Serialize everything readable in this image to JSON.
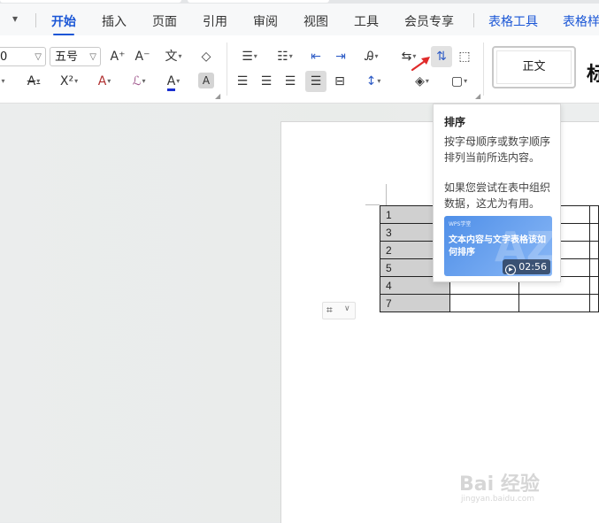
{
  "ribbon_tabs": {
    "items": [
      {
        "label": "开始",
        "active": true
      },
      {
        "label": "插入"
      },
      {
        "label": "页面"
      },
      {
        "label": "引用"
      },
      {
        "label": "审阅"
      },
      {
        "label": "视图"
      },
      {
        "label": "工具"
      },
      {
        "label": "会员专享"
      }
    ],
    "contextual": [
      {
        "label": "表格工具"
      },
      {
        "label": "表格样式"
      }
    ],
    "accent_color": "#1a56d6"
  },
  "font": {
    "name_fragment": "0",
    "size": "五号",
    "increase_icon": "A⁺",
    "decrease_icon": "A⁻",
    "phonetic_icon": "文",
    "clear_icon": "◇",
    "strike_icon": "A",
    "superscript_icon": "X²",
    "effect_icon": "A",
    "highlight_icon": "ℒ",
    "color_icon": "A",
    "shade_icon": "A"
  },
  "styles": {
    "normal_label": "正文",
    "next_label_fragment": "标"
  },
  "tooltip": {
    "title": "排序",
    "description": "按字母顺序或数字顺序排列当前所选内容。",
    "hint": "如果您尝试在表中组织数据，这尤为有用。",
    "video_brand": "WPS学堂",
    "video_title": "文本内容与文字表格该如何排序",
    "duration": "02:56"
  },
  "table": {
    "rows": [
      "1",
      "3",
      "2",
      "5",
      "4",
      "7"
    ]
  },
  "watermark": {
    "logo": "Bai 经验",
    "url": "jingyan.baidu.com"
  }
}
